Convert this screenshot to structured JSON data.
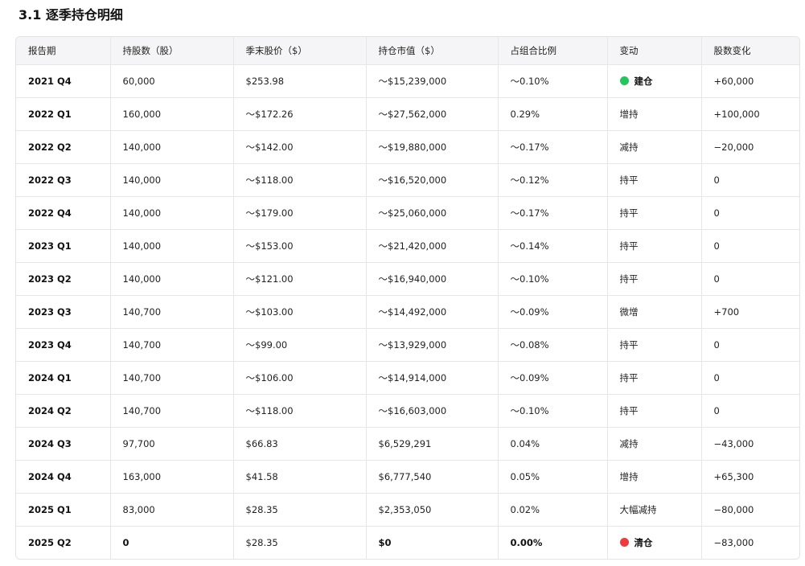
{
  "section_title": "3.1 逐季持仓明细",
  "colors": {
    "build_dot": "#22c55e",
    "clear_dot": "#ef3b3b"
  },
  "table": {
    "headers": [
      "报告期",
      "持股数（股）",
      "季末股价（$）",
      "持仓市值（$）",
      "占组合比例",
      "变动",
      "股数变化"
    ],
    "rows": [
      {
        "period": "2021 Q4",
        "shares": "60,000",
        "price": "$253.98",
        "value": "～$15,239,000",
        "pct": "～0.10%",
        "change": "建仓",
        "delta": "+60,000",
        "icon": "green-dot-icon",
        "emphasis": false
      },
      {
        "period": "2022 Q1",
        "shares": "160,000",
        "price": "～$172.26",
        "value": "～$27,562,000",
        "pct": "0.29%",
        "change": "增持",
        "delta": "+100,000",
        "icon": "",
        "emphasis": false
      },
      {
        "period": "2022 Q2",
        "shares": "140,000",
        "price": "～$142.00",
        "value": "～$19,880,000",
        "pct": "～0.17%",
        "change": "减持",
        "delta": "−20,000",
        "icon": "",
        "emphasis": false
      },
      {
        "period": "2022 Q3",
        "shares": "140,000",
        "price": "～$118.00",
        "value": "～$16,520,000",
        "pct": "～0.12%",
        "change": "持平",
        "delta": "0",
        "icon": "",
        "emphasis": false
      },
      {
        "period": "2022 Q4",
        "shares": "140,000",
        "price": "～$179.00",
        "value": "～$25,060,000",
        "pct": "～0.17%",
        "change": "持平",
        "delta": "0",
        "icon": "",
        "emphasis": false
      },
      {
        "period": "2023 Q1",
        "shares": "140,000",
        "price": "～$153.00",
        "value": "～$21,420,000",
        "pct": "～0.14%",
        "change": "持平",
        "delta": "0",
        "icon": "",
        "emphasis": false
      },
      {
        "period": "2023 Q2",
        "shares": "140,000",
        "price": "～$121.00",
        "value": "～$16,940,000",
        "pct": "～0.10%",
        "change": "持平",
        "delta": "0",
        "icon": "",
        "emphasis": false
      },
      {
        "period": "2023 Q3",
        "shares": "140,700",
        "price": "～$103.00",
        "value": "～$14,492,000",
        "pct": "～0.09%",
        "change": "微增",
        "delta": "+700",
        "icon": "",
        "emphasis": false
      },
      {
        "period": "2023 Q4",
        "shares": "140,700",
        "price": "～$99.00",
        "value": "～$13,929,000",
        "pct": "～0.08%",
        "change": "持平",
        "delta": "0",
        "icon": "",
        "emphasis": false
      },
      {
        "period": "2024 Q1",
        "shares": "140,700",
        "price": "～$106.00",
        "value": "～$14,914,000",
        "pct": "～0.09%",
        "change": "持平",
        "delta": "0",
        "icon": "",
        "emphasis": false
      },
      {
        "period": "2024 Q2",
        "shares": "140,700",
        "price": "～$118.00",
        "value": "～$16,603,000",
        "pct": "～0.10%",
        "change": "持平",
        "delta": "0",
        "icon": "",
        "emphasis": false
      },
      {
        "period": "2024 Q3",
        "shares": "97,700",
        "price": "$66.83",
        "value": "$6,529,291",
        "pct": "0.04%",
        "change": "减持",
        "delta": "−43,000",
        "icon": "",
        "emphasis": false
      },
      {
        "period": "2024 Q4",
        "shares": "163,000",
        "price": "$41.58",
        "value": "$6,777,540",
        "pct": "0.05%",
        "change": "增持",
        "delta": "+65,300",
        "icon": "",
        "emphasis": false
      },
      {
        "period": "2025 Q1",
        "shares": "83,000",
        "price": "$28.35",
        "value": "$2,353,050",
        "pct": "0.02%",
        "change": "大幅减持",
        "delta": "−80,000",
        "icon": "",
        "emphasis": false
      },
      {
        "period": "2025 Q2",
        "shares": "0",
        "price": "$28.35",
        "value": "$0",
        "pct": "0.00%",
        "change": "清仓",
        "delta": "−83,000",
        "icon": "red-dot-icon",
        "emphasis": true
      }
    ]
  }
}
